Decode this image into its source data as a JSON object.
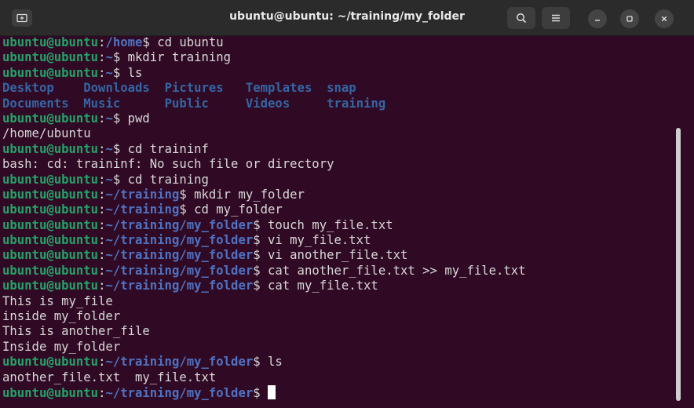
{
  "window": {
    "title": "ubuntu@ubuntu: ~/training/my_folder"
  },
  "prompt_user": "ubuntu@ubuntu",
  "lines": [
    {
      "kind": "prompt",
      "path": "/home",
      "cmd": "cd ubuntu"
    },
    {
      "kind": "prompt",
      "path": "~",
      "cmd": "mkdir training"
    },
    {
      "kind": "prompt",
      "path": "~",
      "cmd": "ls"
    },
    {
      "kind": "ls",
      "items": [
        "Desktop",
        "Downloads",
        "Pictures",
        "Templates",
        "snap"
      ]
    },
    {
      "kind": "ls",
      "items": [
        "Documents",
        "Music",
        "Public",
        "Videos",
        "training"
      ]
    },
    {
      "kind": "prompt",
      "path": "~",
      "cmd": "pwd"
    },
    {
      "kind": "output",
      "text": "/home/ubuntu"
    },
    {
      "kind": "prompt",
      "path": "~",
      "cmd": "cd traininf"
    },
    {
      "kind": "output",
      "text": "bash: cd: traininf: No such file or directory"
    },
    {
      "kind": "prompt",
      "path": "~",
      "cmd": "cd training"
    },
    {
      "kind": "prompt",
      "path": "~/training",
      "cmd": "mkdir my_folder"
    },
    {
      "kind": "prompt",
      "path": "~/training",
      "cmd": "cd my_folder"
    },
    {
      "kind": "prompt",
      "path": "~/training/my_folder",
      "cmd": "touch my_file.txt"
    },
    {
      "kind": "prompt",
      "path": "~/training/my_folder",
      "cmd": "vi my_file.txt"
    },
    {
      "kind": "prompt",
      "path": "~/training/my_folder",
      "cmd": "vi another_file.txt"
    },
    {
      "kind": "prompt",
      "path": "~/training/my_folder",
      "cmd": "cat another_file.txt >> my_file.txt"
    },
    {
      "kind": "prompt",
      "path": "~/training/my_folder",
      "cmd": "cat my_file.txt"
    },
    {
      "kind": "output",
      "text": "This is my_file"
    },
    {
      "kind": "output",
      "text": "inside my_folder"
    },
    {
      "kind": "output",
      "text": "This is another_file"
    },
    {
      "kind": "output",
      "text": "Inside my_folder"
    },
    {
      "kind": "prompt",
      "path": "~/training/my_folder",
      "cmd": "ls"
    },
    {
      "kind": "output",
      "text": "another_file.txt  my_file.txt"
    },
    {
      "kind": "prompt",
      "path": "~/training/my_folder",
      "cmd": "",
      "cursor": true
    }
  ],
  "colors": {
    "background": "#300a24",
    "user": "#26a269",
    "path": "#4f72c2",
    "directory": "#3465a4",
    "text": "#d8d8d8"
  },
  "icons": {
    "new_tab": "new-tab-icon",
    "search": "search-icon",
    "menu": "hamburger-menu-icon",
    "minimize": "minimize-icon",
    "maximize": "maximize-icon",
    "close": "close-icon"
  }
}
